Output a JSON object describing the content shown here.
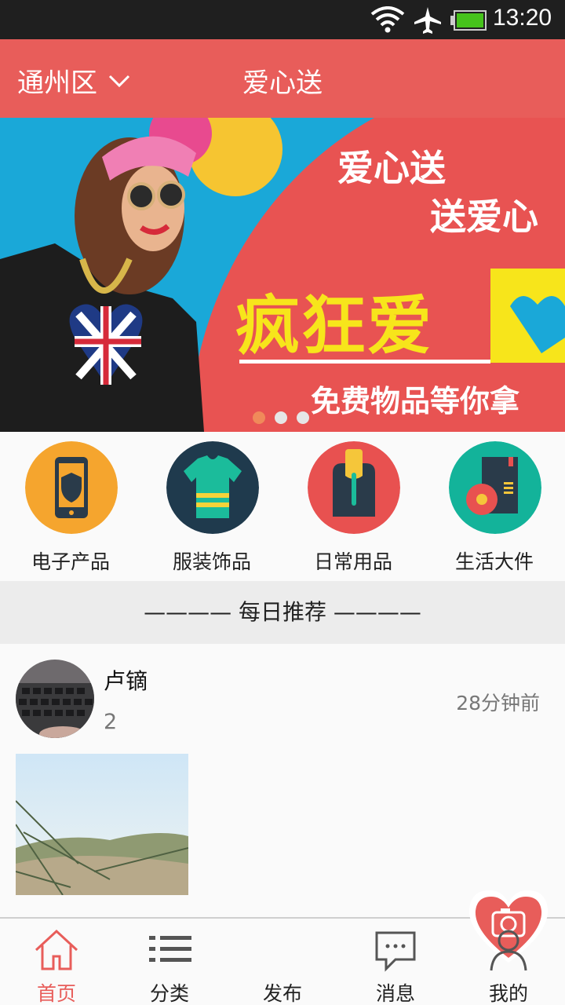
{
  "status_bar": {
    "time": "13:20",
    "icons": [
      "wifi-icon",
      "airplane-icon",
      "battery-icon"
    ]
  },
  "header": {
    "location": "通州区",
    "title": "爱心送"
  },
  "banner": {
    "line1": "爱心送",
    "line2": "送爱心",
    "headline": "疯狂爱",
    "subline": "免费物品等你拿",
    "slide_count": 3,
    "active_slide": 1
  },
  "categories": [
    {
      "label": "电子产品",
      "icon": "phone-icon",
      "color": "#f5a52e"
    },
    {
      "label": "服装饰品",
      "icon": "shirt-icon",
      "color": "#1f3a4d"
    },
    {
      "label": "日常用品",
      "icon": "bag-icon",
      "color": "#e85150"
    },
    {
      "label": "生活大件",
      "icon": "appliance-icon",
      "color": "#13b39a"
    }
  ],
  "section": {
    "title": "———— 每日推荐 ————"
  },
  "feed": [
    {
      "username": "卢镝",
      "count": "2",
      "time": "28分钟前"
    }
  ],
  "bottom_nav": [
    {
      "label": "首页",
      "icon": "home-icon",
      "active": true
    },
    {
      "label": "分类",
      "icon": "list-icon",
      "active": false
    },
    {
      "label": "发布",
      "icon": "camera-heart-icon",
      "active": false
    },
    {
      "label": "消息",
      "icon": "message-icon",
      "active": false
    },
    {
      "label": "我的",
      "icon": "user-icon",
      "active": false
    }
  ],
  "colors": {
    "accent": "#e85d5a",
    "status_bar": "#1f1f1f"
  }
}
